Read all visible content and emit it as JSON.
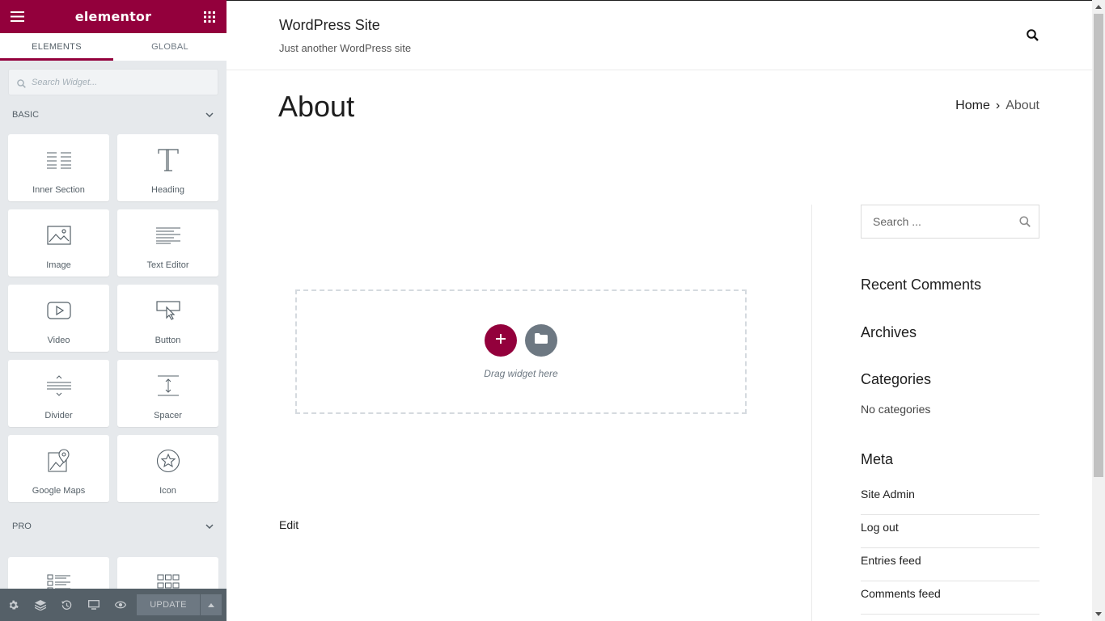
{
  "panel": {
    "logo": "elementor",
    "tabs": [
      {
        "label": "ELEMENTS",
        "active": true
      },
      {
        "label": "GLOBAL",
        "active": false
      }
    ],
    "search_placeholder": "Search Widget...",
    "categories": {
      "basic": "BASIC",
      "pro": "PRO"
    },
    "widgets": [
      {
        "label": "Inner Section",
        "icon": "inner-section-icon"
      },
      {
        "label": "Heading",
        "icon": "heading-icon"
      },
      {
        "label": "Image",
        "icon": "image-icon"
      },
      {
        "label": "Text Editor",
        "icon": "text-editor-icon"
      },
      {
        "label": "Video",
        "icon": "video-icon"
      },
      {
        "label": "Button",
        "icon": "button-icon"
      },
      {
        "label": "Divider",
        "icon": "divider-icon"
      },
      {
        "label": "Spacer",
        "icon": "spacer-icon"
      },
      {
        "label": "Google Maps",
        "icon": "google-maps-icon"
      },
      {
        "label": "Icon",
        "icon": "star-icon"
      }
    ],
    "footer": {
      "update_label": "UPDATE"
    },
    "colors": {
      "brand": "#93003c",
      "panel_bg": "#e6e9ec",
      "footer_bg": "#556068"
    }
  },
  "site": {
    "title": "WordPress Site",
    "tagline": "Just another WordPress site"
  },
  "page": {
    "title": "About",
    "breadcrumb": {
      "home": "Home",
      "separator": "›",
      "current": "About"
    },
    "drop_zone_text": "Drag widget here",
    "edit_link": "Edit"
  },
  "sidebar": {
    "search_placeholder": "Search ...",
    "recent_comments": "Recent Comments",
    "archives": "Archives",
    "categories": "Categories",
    "no_categories": "No categories",
    "meta": "Meta",
    "meta_items": [
      "Site Admin",
      "Log out",
      "Entries feed",
      "Comments feed"
    ]
  }
}
